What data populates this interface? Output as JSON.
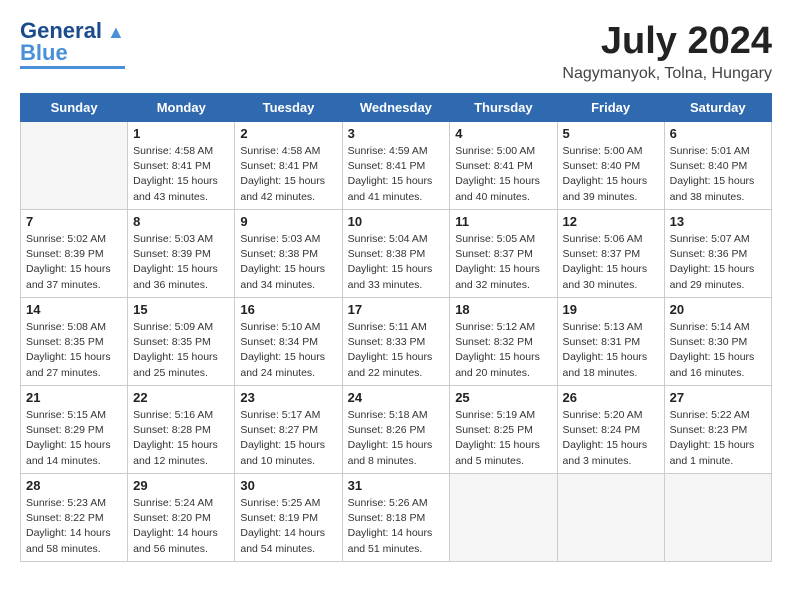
{
  "header": {
    "logo_line1": "General",
    "logo_line2": "Blue",
    "month_year": "July 2024",
    "location": "Nagymanyok, Tolna, Hungary"
  },
  "days_of_week": [
    "Sunday",
    "Monday",
    "Tuesday",
    "Wednesday",
    "Thursday",
    "Friday",
    "Saturday"
  ],
  "weeks": [
    [
      {
        "num": "",
        "empty": true
      },
      {
        "num": "1",
        "sunrise": "Sunrise: 4:58 AM",
        "sunset": "Sunset: 8:41 PM",
        "daylight": "Daylight: 15 hours and 43 minutes."
      },
      {
        "num": "2",
        "sunrise": "Sunrise: 4:58 AM",
        "sunset": "Sunset: 8:41 PM",
        "daylight": "Daylight: 15 hours and 42 minutes."
      },
      {
        "num": "3",
        "sunrise": "Sunrise: 4:59 AM",
        "sunset": "Sunset: 8:41 PM",
        "daylight": "Daylight: 15 hours and 41 minutes."
      },
      {
        "num": "4",
        "sunrise": "Sunrise: 5:00 AM",
        "sunset": "Sunset: 8:41 PM",
        "daylight": "Daylight: 15 hours and 40 minutes."
      },
      {
        "num": "5",
        "sunrise": "Sunrise: 5:00 AM",
        "sunset": "Sunset: 8:40 PM",
        "daylight": "Daylight: 15 hours and 39 minutes."
      },
      {
        "num": "6",
        "sunrise": "Sunrise: 5:01 AM",
        "sunset": "Sunset: 8:40 PM",
        "daylight": "Daylight: 15 hours and 38 minutes."
      }
    ],
    [
      {
        "num": "7",
        "sunrise": "Sunrise: 5:02 AM",
        "sunset": "Sunset: 8:39 PM",
        "daylight": "Daylight: 15 hours and 37 minutes."
      },
      {
        "num": "8",
        "sunrise": "Sunrise: 5:03 AM",
        "sunset": "Sunset: 8:39 PM",
        "daylight": "Daylight: 15 hours and 36 minutes."
      },
      {
        "num": "9",
        "sunrise": "Sunrise: 5:03 AM",
        "sunset": "Sunset: 8:38 PM",
        "daylight": "Daylight: 15 hours and 34 minutes."
      },
      {
        "num": "10",
        "sunrise": "Sunrise: 5:04 AM",
        "sunset": "Sunset: 8:38 PM",
        "daylight": "Daylight: 15 hours and 33 minutes."
      },
      {
        "num": "11",
        "sunrise": "Sunrise: 5:05 AM",
        "sunset": "Sunset: 8:37 PM",
        "daylight": "Daylight: 15 hours and 32 minutes."
      },
      {
        "num": "12",
        "sunrise": "Sunrise: 5:06 AM",
        "sunset": "Sunset: 8:37 PM",
        "daylight": "Daylight: 15 hours and 30 minutes."
      },
      {
        "num": "13",
        "sunrise": "Sunrise: 5:07 AM",
        "sunset": "Sunset: 8:36 PM",
        "daylight": "Daylight: 15 hours and 29 minutes."
      }
    ],
    [
      {
        "num": "14",
        "sunrise": "Sunrise: 5:08 AM",
        "sunset": "Sunset: 8:35 PM",
        "daylight": "Daylight: 15 hours and 27 minutes."
      },
      {
        "num": "15",
        "sunrise": "Sunrise: 5:09 AM",
        "sunset": "Sunset: 8:35 PM",
        "daylight": "Daylight: 15 hours and 25 minutes."
      },
      {
        "num": "16",
        "sunrise": "Sunrise: 5:10 AM",
        "sunset": "Sunset: 8:34 PM",
        "daylight": "Daylight: 15 hours and 24 minutes."
      },
      {
        "num": "17",
        "sunrise": "Sunrise: 5:11 AM",
        "sunset": "Sunset: 8:33 PM",
        "daylight": "Daylight: 15 hours and 22 minutes."
      },
      {
        "num": "18",
        "sunrise": "Sunrise: 5:12 AM",
        "sunset": "Sunset: 8:32 PM",
        "daylight": "Daylight: 15 hours and 20 minutes."
      },
      {
        "num": "19",
        "sunrise": "Sunrise: 5:13 AM",
        "sunset": "Sunset: 8:31 PM",
        "daylight": "Daylight: 15 hours and 18 minutes."
      },
      {
        "num": "20",
        "sunrise": "Sunrise: 5:14 AM",
        "sunset": "Sunset: 8:30 PM",
        "daylight": "Daylight: 15 hours and 16 minutes."
      }
    ],
    [
      {
        "num": "21",
        "sunrise": "Sunrise: 5:15 AM",
        "sunset": "Sunset: 8:29 PM",
        "daylight": "Daylight: 15 hours and 14 minutes."
      },
      {
        "num": "22",
        "sunrise": "Sunrise: 5:16 AM",
        "sunset": "Sunset: 8:28 PM",
        "daylight": "Daylight: 15 hours and 12 minutes."
      },
      {
        "num": "23",
        "sunrise": "Sunrise: 5:17 AM",
        "sunset": "Sunset: 8:27 PM",
        "daylight": "Daylight: 15 hours and 10 minutes."
      },
      {
        "num": "24",
        "sunrise": "Sunrise: 5:18 AM",
        "sunset": "Sunset: 8:26 PM",
        "daylight": "Daylight: 15 hours and 8 minutes."
      },
      {
        "num": "25",
        "sunrise": "Sunrise: 5:19 AM",
        "sunset": "Sunset: 8:25 PM",
        "daylight": "Daylight: 15 hours and 5 minutes."
      },
      {
        "num": "26",
        "sunrise": "Sunrise: 5:20 AM",
        "sunset": "Sunset: 8:24 PM",
        "daylight": "Daylight: 15 hours and 3 minutes."
      },
      {
        "num": "27",
        "sunrise": "Sunrise: 5:22 AM",
        "sunset": "Sunset: 8:23 PM",
        "daylight": "Daylight: 15 hours and 1 minute."
      }
    ],
    [
      {
        "num": "28",
        "sunrise": "Sunrise: 5:23 AM",
        "sunset": "Sunset: 8:22 PM",
        "daylight": "Daylight: 14 hours and 58 minutes."
      },
      {
        "num": "29",
        "sunrise": "Sunrise: 5:24 AM",
        "sunset": "Sunset: 8:20 PM",
        "daylight": "Daylight: 14 hours and 56 minutes."
      },
      {
        "num": "30",
        "sunrise": "Sunrise: 5:25 AM",
        "sunset": "Sunset: 8:19 PM",
        "daylight": "Daylight: 14 hours and 54 minutes."
      },
      {
        "num": "31",
        "sunrise": "Sunrise: 5:26 AM",
        "sunset": "Sunset: 8:18 PM",
        "daylight": "Daylight: 14 hours and 51 minutes."
      },
      {
        "num": "",
        "empty": true
      },
      {
        "num": "",
        "empty": true
      },
      {
        "num": "",
        "empty": true
      }
    ]
  ]
}
